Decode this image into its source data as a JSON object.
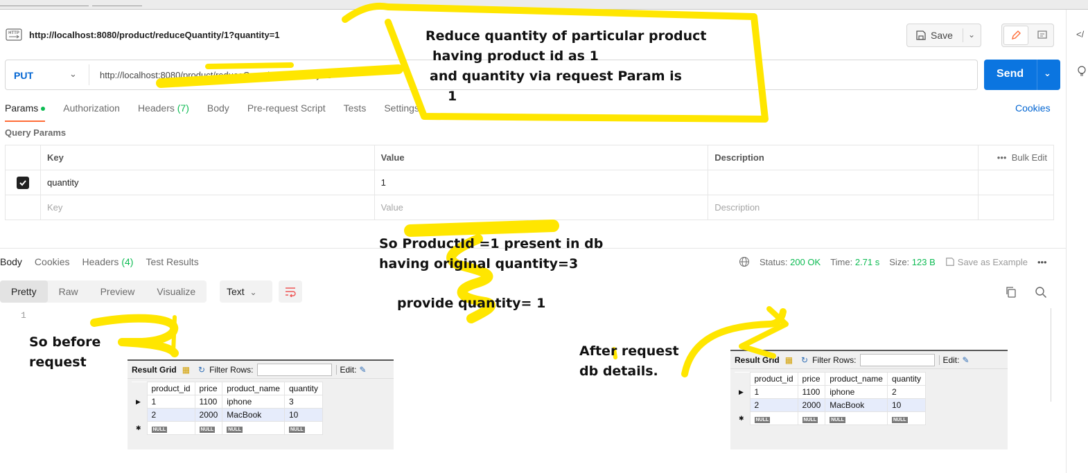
{
  "request": {
    "title_url": "http://localhost:8080/product/reduceQuantity/1?quantity=1",
    "method": "PUT",
    "url": "http://localhost:8080/product/reduceQuantity/1?quantity=1",
    "save_label": "Save",
    "send_label": "Send",
    "cookies_label": "Cookies"
  },
  "request_tabs": [
    {
      "label": "Params",
      "active": true
    },
    {
      "label": "Authorization"
    },
    {
      "label": "Headers",
      "count": "(7)"
    },
    {
      "label": "Body"
    },
    {
      "label": "Pre-request Script"
    },
    {
      "label": "Tests"
    },
    {
      "label": "Settings"
    }
  ],
  "query_params": {
    "label": "Query Params",
    "headers": {
      "key": "Key",
      "value": "Value",
      "description": "Description",
      "bulk": "Bulk Edit"
    },
    "rows": [
      {
        "key": "quantity",
        "value": "1",
        "checked": true
      }
    ],
    "placeholders": {
      "key": "Key",
      "value": "Value",
      "description": "Description"
    }
  },
  "response": {
    "tabs": [
      {
        "label": "Body",
        "active": true
      },
      {
        "label": "Cookies"
      },
      {
        "label": "Headers",
        "count": "(4)"
      },
      {
        "label": "Test Results"
      }
    ],
    "status_label": "Status:",
    "status": "200 OK",
    "time_label": "Time:",
    "time": "2.71 s",
    "size_label": "Size:",
    "size": "123 B",
    "save_example": "Save as Example",
    "view_tabs": [
      "Pretty",
      "Raw",
      "Preview",
      "Visualize"
    ],
    "format": "Text",
    "line_number": "1"
  },
  "annotations": {
    "top": [
      "Reduce quantity of particular product",
      "having product id as 1",
      "and quantity via request Param is",
      "1"
    ],
    "middle": [
      "So ProductId =1 present in db",
      "having original quantity=3"
    ],
    "provide": "provide quantity= 1",
    "before": [
      "So before",
      "request"
    ],
    "after": [
      "After request",
      "db details."
    ]
  },
  "db_before": {
    "result_grid": "Result Grid",
    "filter_rows": "Filter Rows:",
    "edit": "Edit:",
    "columns": [
      "product_id",
      "price",
      "product_name",
      "quantity"
    ],
    "rows": [
      [
        "1",
        "1100",
        "iphone",
        "3"
      ],
      [
        "2",
        "2000",
        "MacBook",
        "10"
      ]
    ],
    "null": "NULL"
  },
  "db_after": {
    "result_grid": "Result Grid",
    "filter_rows": "Filter Rows:",
    "edit": "Edit:",
    "columns": [
      "product_id",
      "price",
      "product_name",
      "quantity"
    ],
    "rows": [
      [
        "1",
        "1100",
        "iphone",
        "2"
      ],
      [
        "2",
        "2000",
        "MacBook",
        "10"
      ]
    ],
    "null": "NULL"
  },
  "colors": {
    "accent": "#ff6c37",
    "send": "#0b75e0",
    "method": "#0265d2",
    "ok": "#0cbb52",
    "highlighter": "#ffe600"
  }
}
